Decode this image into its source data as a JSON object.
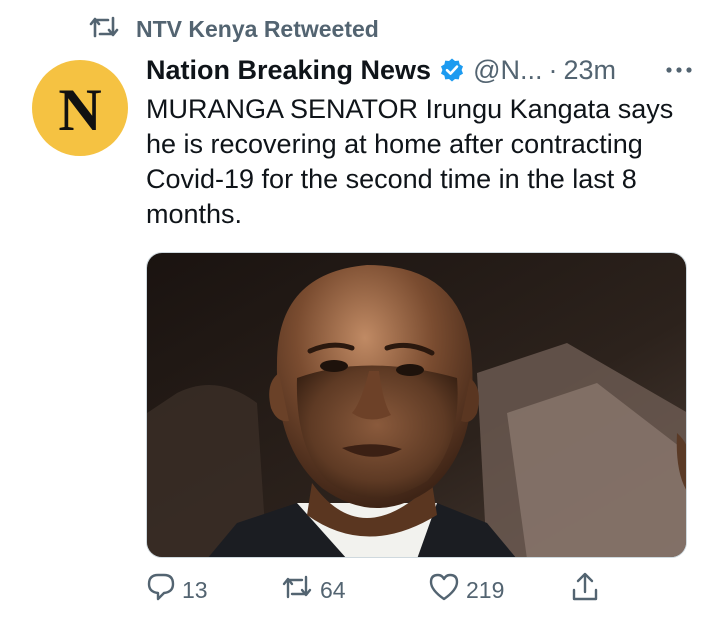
{
  "retweet_banner": {
    "text": "NTV Kenya Retweeted",
    "icon": "retweet-icon"
  },
  "author": {
    "avatar_letter": "N",
    "avatar_color": "#f5c242",
    "name": "Nation Breaking News",
    "verified": true,
    "verified_color": "#1d9bf0",
    "handle": "@N...",
    "separator": "·",
    "time": "23m"
  },
  "tweet": {
    "text": "MURANGA SENATOR Irungu Kangata says he is recovering at home after contracting Covid-19 for the second time in the last 8 months."
  },
  "media": {
    "kind": "photo",
    "subject": "portrait of a man in a dark suit and white shirt"
  },
  "actions": {
    "reply_count": "13",
    "retweet_count": "64",
    "like_count": "219",
    "share_icon": "share-icon"
  },
  "colors": {
    "muted": "#536471",
    "text": "#0f1419",
    "accent": "#1d9bf0"
  }
}
